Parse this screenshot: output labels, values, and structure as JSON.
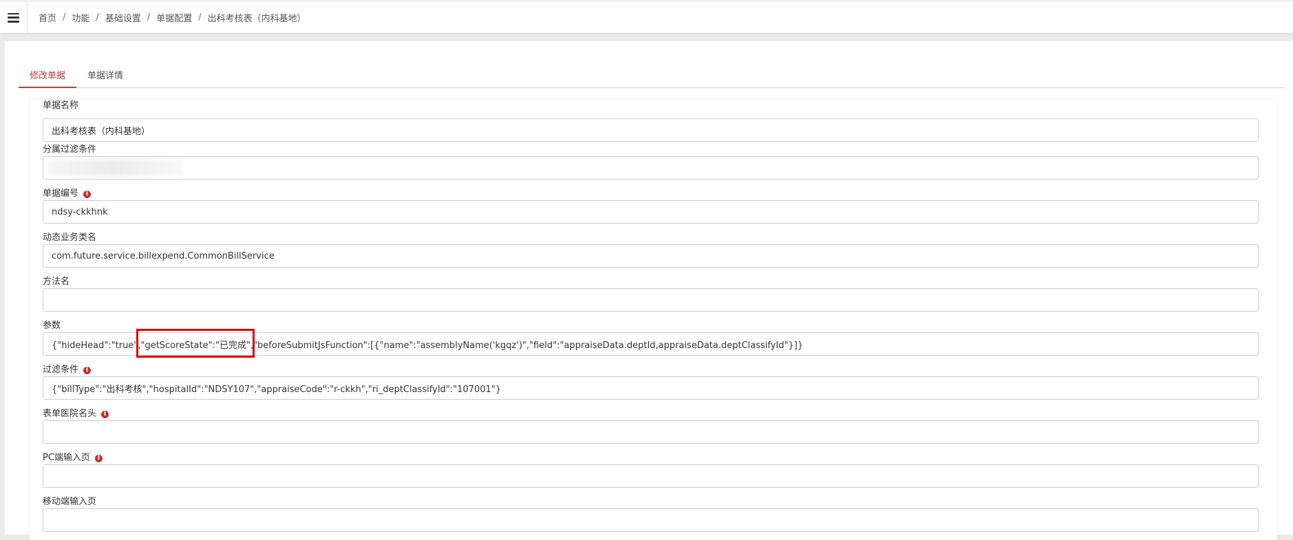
{
  "breadcrumb": {
    "items": [
      "首页",
      "功能",
      "基础设置",
      "单据配置",
      "出科考核表（内科基地）"
    ],
    "separator": "/"
  },
  "tabs": [
    {
      "label": "修改单据",
      "active": true
    },
    {
      "label": "单据详情",
      "active": false
    }
  ],
  "form": {
    "bill_name": {
      "label": "单据名称",
      "value": "出科考核表（内科基地）"
    },
    "filter_branch": {
      "label": "分属过滤条件",
      "value": ""
    },
    "bill_code": {
      "label": "单据编号",
      "value": "ndsy-ckkhnk"
    },
    "dynamic_class": {
      "label": "动态业务类名",
      "value": "com.future.service.billexpend.CommonBillService"
    },
    "method_name": {
      "label": "方法名",
      "value": ""
    },
    "params": {
      "label": "参数",
      "value": "{\"hideHead\":\"true\",\"getScoreState\":\"已完成\",\"beforeSubmitJsFunction\":[{\"name\":\"assemblyName('kgqz')\",\"field\":\"appraiseData.deptId,appraiseData.deptClassifyId\"}]}"
    },
    "filter_cond": {
      "label": "过滤条件",
      "value": "{\"billType\":\"出科考核\",\"hospitalId\":\"NDSY107\",\"appraiseCode\":\"r-ckkh\",\"ri_deptClassifyId\":\"107001\"}"
    },
    "hospital_header": {
      "label": "表单医院名头",
      "value": ""
    },
    "pc_input_page": {
      "label": "PC端输入页",
      "value": ""
    },
    "mobile_input_page": {
      "label": "移动端输入页",
      "value": ""
    }
  },
  "icons": {
    "menu": "menu-icon",
    "info": "info-icon"
  },
  "colors": {
    "accent": "#c23b3b",
    "info_icon": "#c9302c",
    "highlight": "#e10000"
  }
}
